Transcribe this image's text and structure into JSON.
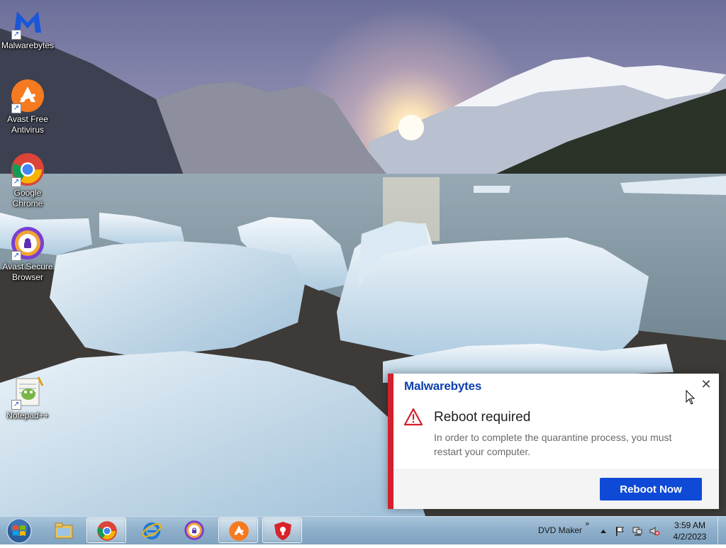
{
  "desktop": {
    "icons": [
      {
        "label": "Malwarebytes",
        "icon": "malwarebytes-icon"
      },
      {
        "label": "Avast Free Antivirus",
        "icon": "avast-antivirus-icon"
      },
      {
        "label": "Google Chrome",
        "icon": "chrome-icon"
      },
      {
        "label": "Avast Secure Browser",
        "icon": "avast-secure-browser-icon"
      },
      {
        "label": "Notepad++",
        "icon": "notepad-plus-plus-icon"
      }
    ]
  },
  "toast": {
    "brand": "Malwarebytes",
    "title": "Reboot required",
    "message": "In order to complete the quarantine process, you must restart your computer.",
    "button": "Reboot Now",
    "close_icon": "close-icon",
    "warning_icon": "warning-triangle-icon",
    "accent_color": "#d4202c",
    "button_color": "#0e4ad6"
  },
  "taskbar": {
    "start_icon": "windows-start-orb-icon",
    "pinned": [
      {
        "icon": "file-explorer-icon",
        "active": false
      },
      {
        "icon": "chrome-icon",
        "active": true
      },
      {
        "icon": "internet-explorer-icon",
        "active": false
      },
      {
        "icon": "avast-secure-browser-icon",
        "active": false
      },
      {
        "icon": "avast-antivirus-icon",
        "active": true
      },
      {
        "icon": "avast-shield-icon",
        "active": true
      }
    ],
    "toolbar_label": "DVD Maker",
    "toolbar_chevron": "»",
    "tray_icons": [
      "show-hidden-icons-arrow",
      "action-center-flag-icon",
      "network-icon",
      "volume-muted-icon"
    ],
    "time": "3:59 AM",
    "date": "4/2/2023"
  }
}
